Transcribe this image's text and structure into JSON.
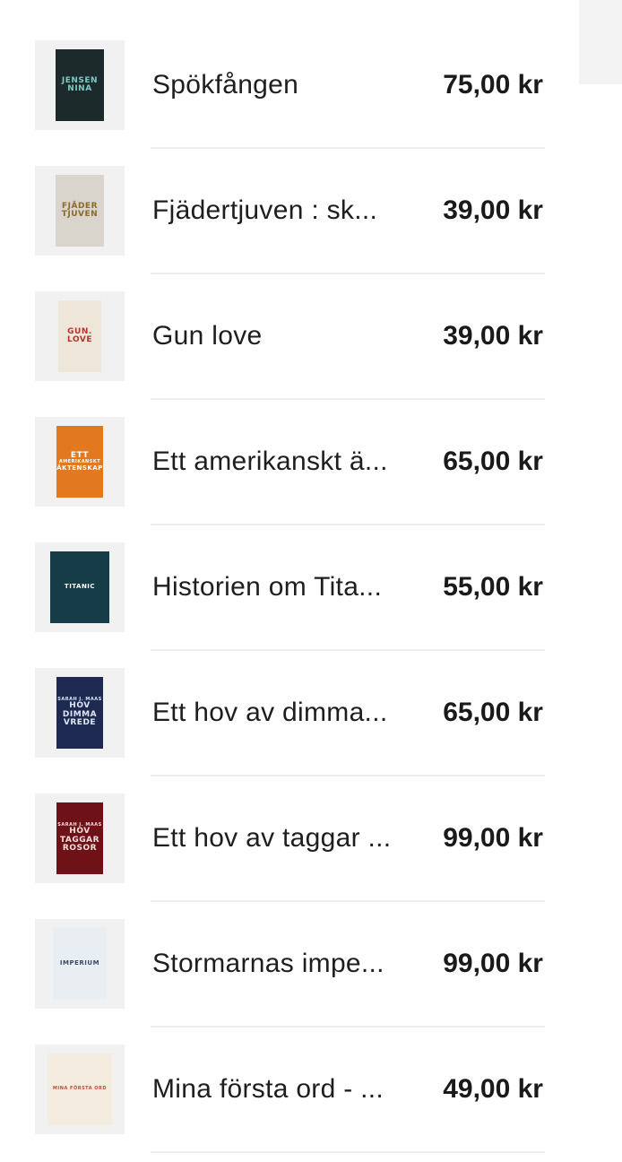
{
  "products": [
    {
      "title": "Spökfången",
      "price": "75,00 kr",
      "cover": {
        "lines": [
          "JENSEN",
          "NINA"
        ],
        "bg": "#1d2a2c",
        "fg": "#7ec9c2",
        "icon": "book-cover-thriller"
      }
    },
    {
      "title": "Fjädertjuven : sk...",
      "price": "39,00 kr",
      "cover": {
        "lines": [
          "FJÄDER",
          "TJUVEN"
        ],
        "bg": "#d9d4cc",
        "fg": "#8a6a2a",
        "icon": "book-cover-feather"
      }
    },
    {
      "title": "Gun love",
      "price": "39,00 kr",
      "cover": {
        "lines": [
          "GUN.",
          "LOVE"
        ],
        "bg": "#efe6da",
        "fg": "#b0352a",
        "icon": "book-cover-gun-love"
      }
    },
    {
      "title": "Ett amerikanskt ä...",
      "price": "65,00 kr",
      "cover": {
        "lines": [
          "ETT",
          "AMERIKANSKT",
          "ÄKTENSKAP"
        ],
        "bg": "#e2791f",
        "fg": "#ffffff",
        "icon": "book-cover-marriage"
      }
    },
    {
      "title": "Historien om Tita...",
      "price": "55,00 kr",
      "cover": {
        "lines": [
          "TITANIC"
        ],
        "bg": "#163c48",
        "fg": "#ffffff",
        "icon": "book-cover-titanic"
      }
    },
    {
      "title": "Ett hov av dimma...",
      "price": "65,00 kr",
      "cover": {
        "lines": [
          "SARAH J. MAAS",
          "HOV",
          "DIMMA",
          "VREDE"
        ],
        "bg": "#1f2a52",
        "fg": "#dfe6f5",
        "icon": "book-cover-mist"
      }
    },
    {
      "title": "Ett hov av taggar ...",
      "price": "99,00 kr",
      "cover": {
        "lines": [
          "SARAH J. MAAS",
          "HOV",
          "TAGGAR",
          "ROSOR"
        ],
        "bg": "#6e1218",
        "fg": "#f3dede",
        "icon": "book-cover-thorns"
      }
    },
    {
      "title": "Stormarnas impe...",
      "price": "99,00 kr",
      "cover": {
        "lines": [
          "IMPERIUM"
        ],
        "bg": "#e9eef3",
        "fg": "#3b4a66",
        "icon": "book-cover-empire"
      }
    },
    {
      "title": "Mina första ord - ...",
      "price": "49,00 kr",
      "cover": {
        "lines": [
          "MINA FÖRSTA ORD"
        ],
        "bg": "#f4ecdf",
        "fg": "#c24b33",
        "icon": "book-cover-first-words"
      }
    }
  ]
}
